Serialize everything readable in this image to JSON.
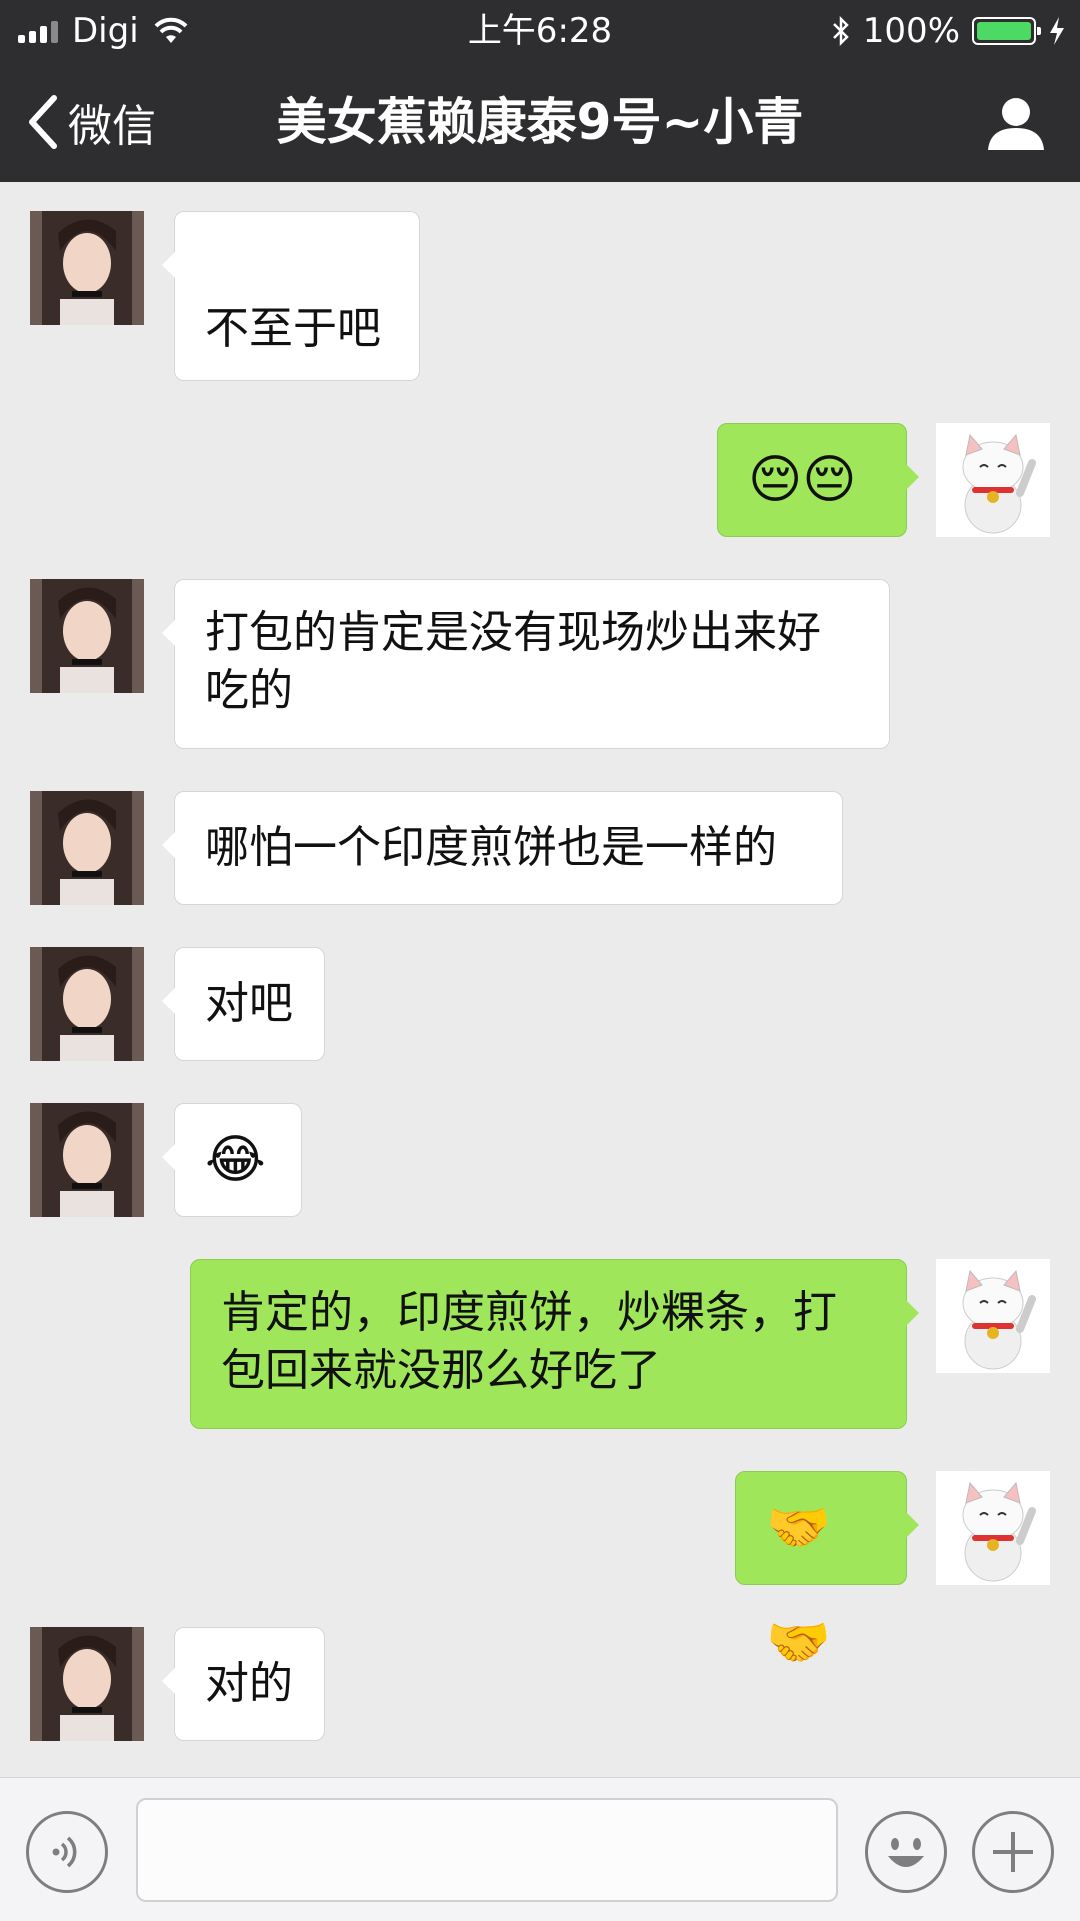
{
  "status_bar": {
    "carrier": "Digi",
    "time": "上午6:28",
    "battery": "100%"
  },
  "nav": {
    "back_label": "微信",
    "title": "美女蕉赖康泰9号~小青"
  },
  "messages": [
    {
      "side": "left",
      "text": "不至于吧"
    },
    {
      "side": "right",
      "text": "😔😔"
    },
    {
      "side": "left",
      "text": "打包的肯定是没有现场炒出来好吃的"
    },
    {
      "side": "left",
      "text": "哪怕一个印度煎饼也是一样的"
    },
    {
      "side": "left",
      "text": "对吧"
    },
    {
      "side": "left",
      "text": "😂"
    },
    {
      "side": "right",
      "text": "肯定的，印度煎饼，炒粿条，打包回来就没那么好吃了"
    },
    {
      "side": "right",
      "text": "🤝🤝"
    },
    {
      "side": "left",
      "text": "对的"
    }
  ],
  "colors": {
    "bar_bg": "#2e2e30",
    "chat_bg": "#ebebeb",
    "bubble_self": "#9fe65a",
    "bubble_other": "#ffffff"
  },
  "icons": {
    "back": "chevron-left-icon",
    "profile": "person-icon",
    "voice": "voice-icon",
    "emoji": "smiley-icon",
    "more": "plus-icon"
  }
}
